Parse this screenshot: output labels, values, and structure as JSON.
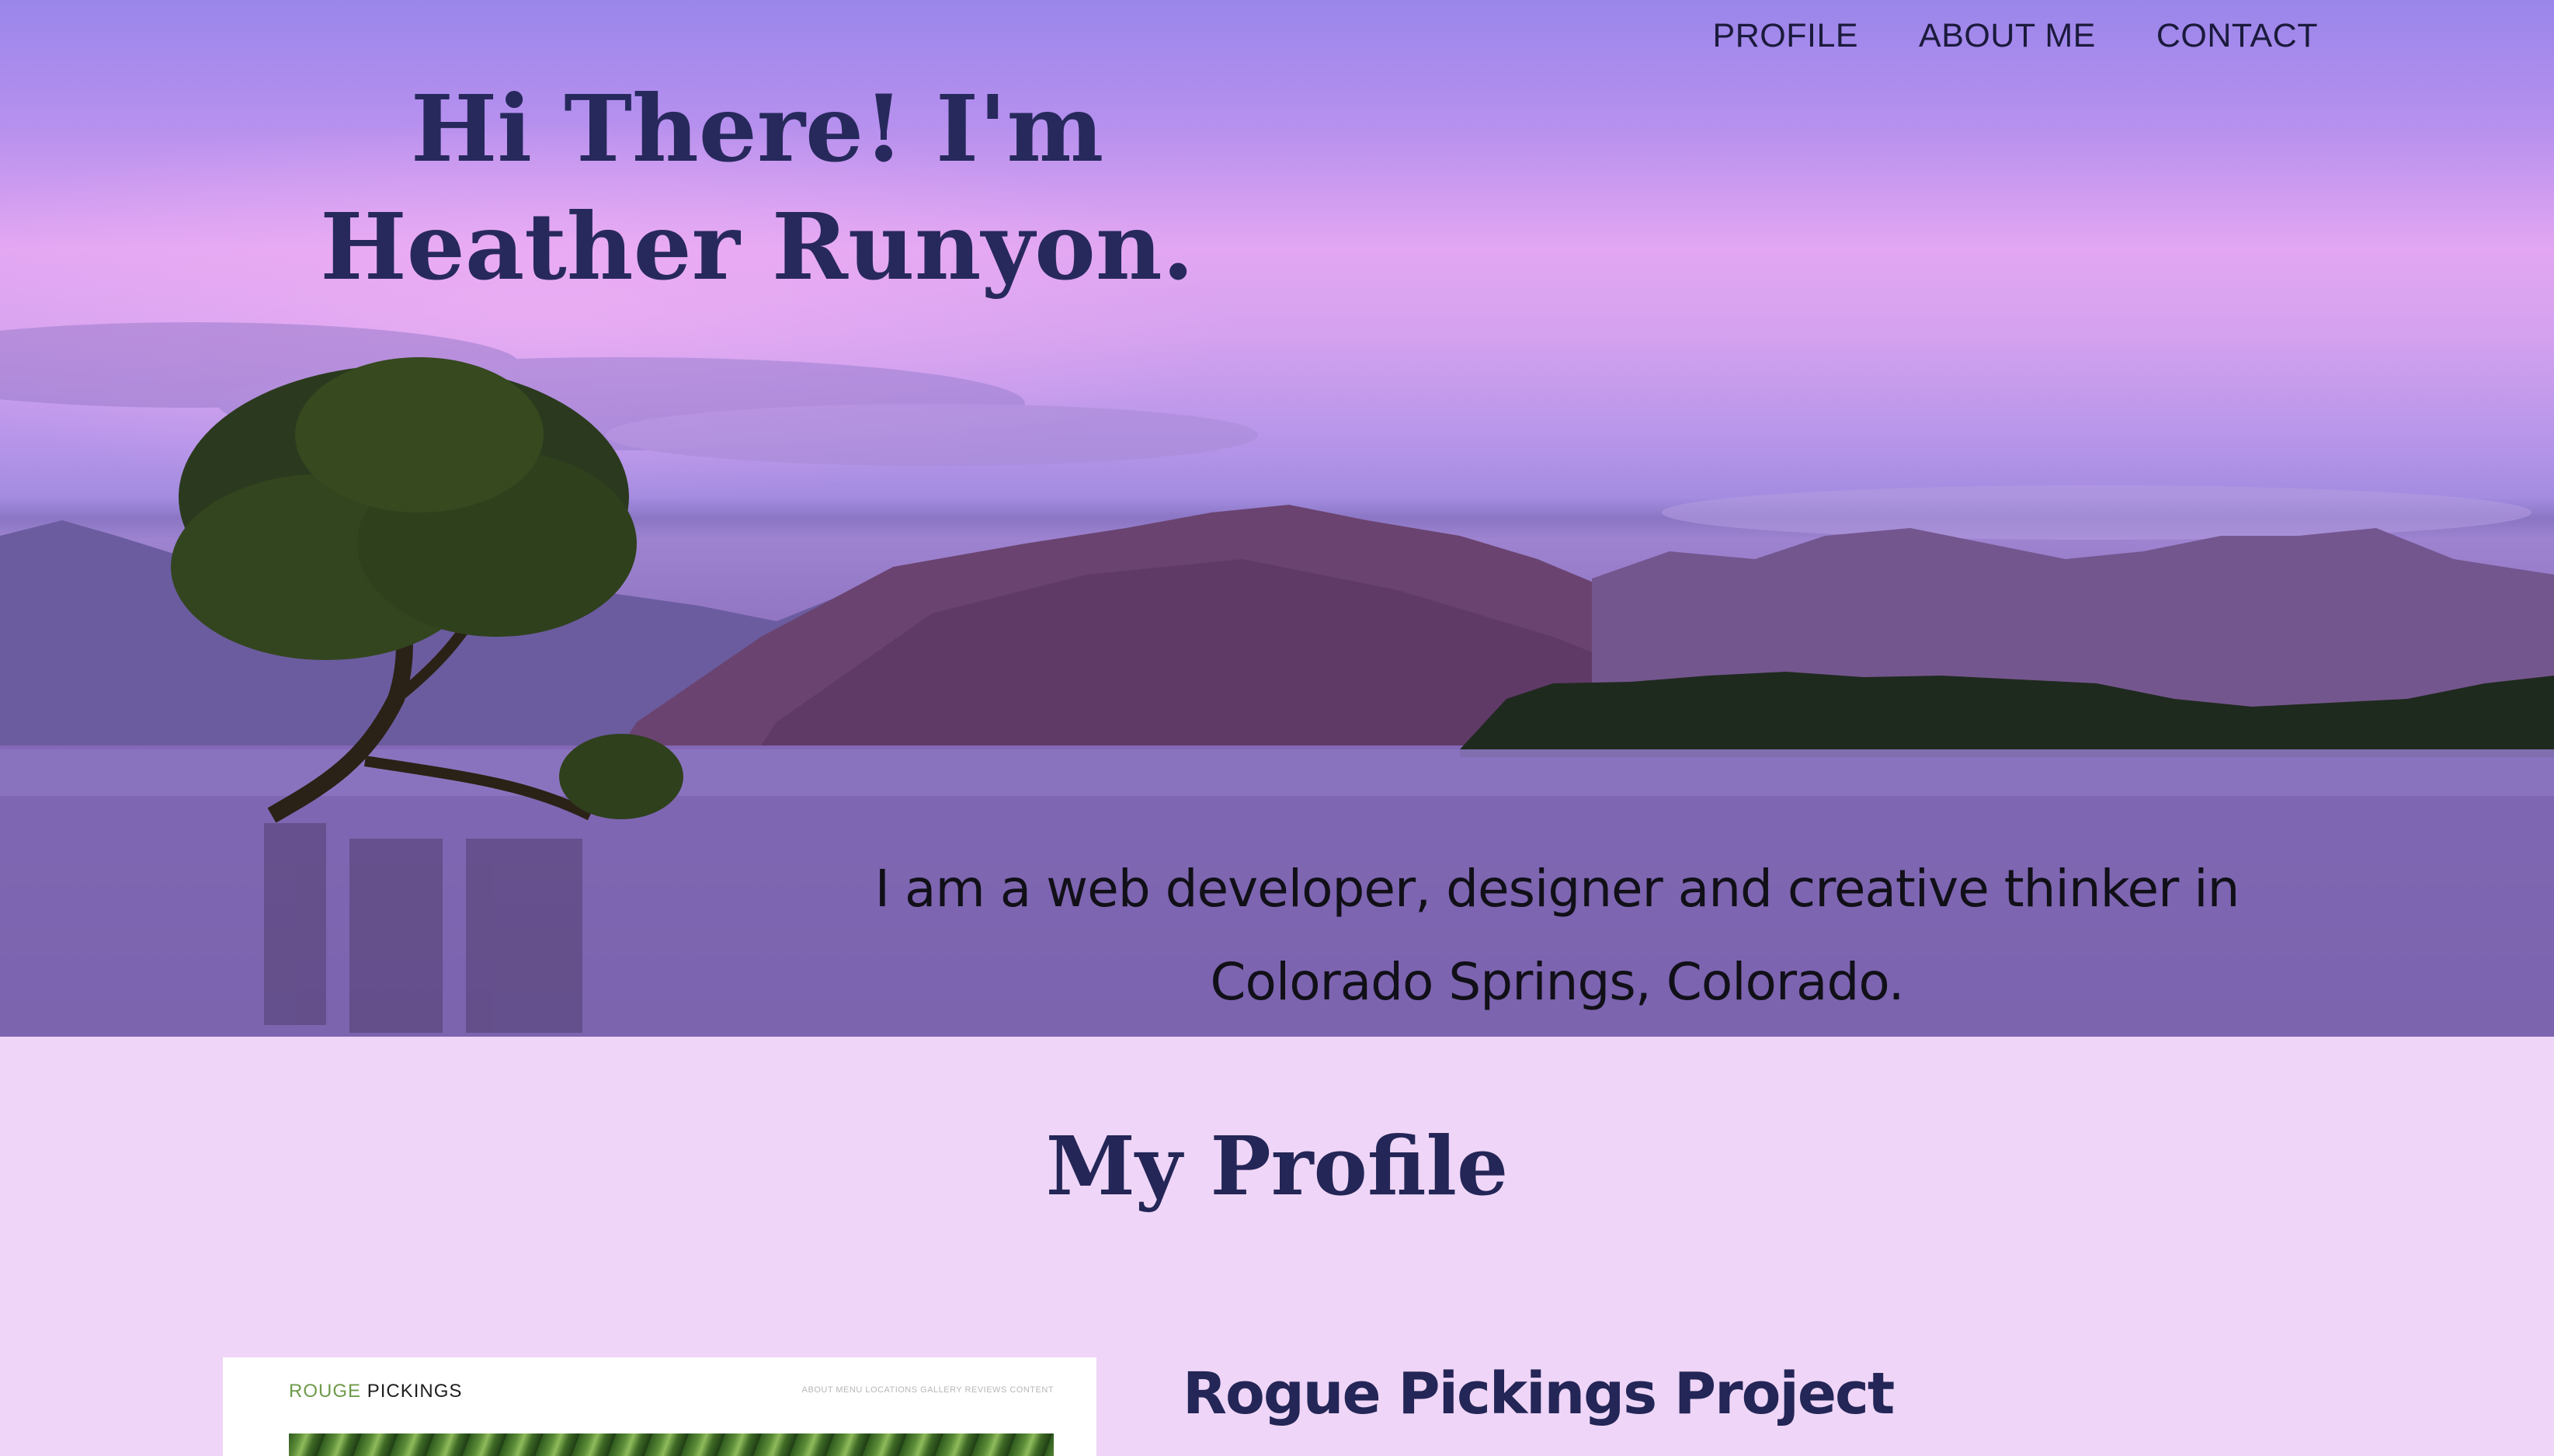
{
  "nav": {
    "items": [
      "PROFILE",
      "ABOUT ME",
      "CONTACT"
    ]
  },
  "hero": {
    "title": "Hi There! I'm Heather Runyon.",
    "tagline": "I am a web developer, designer and creative thinker in Colorado Springs, Colorado."
  },
  "profile": {
    "section_title": "My Profile",
    "project": {
      "title": "Rogue Pickings Project",
      "preview_brand_part1": "ROUGE",
      "preview_brand_part2": "PICKINGS",
      "preview_nav": "ABOUT MENU LOCATIONS GALLERY REVIEWS CONTENT"
    }
  },
  "colors": {
    "heading": "#27295c",
    "section_background": "#efd5f7",
    "nav_text": "#1b1a3c"
  }
}
